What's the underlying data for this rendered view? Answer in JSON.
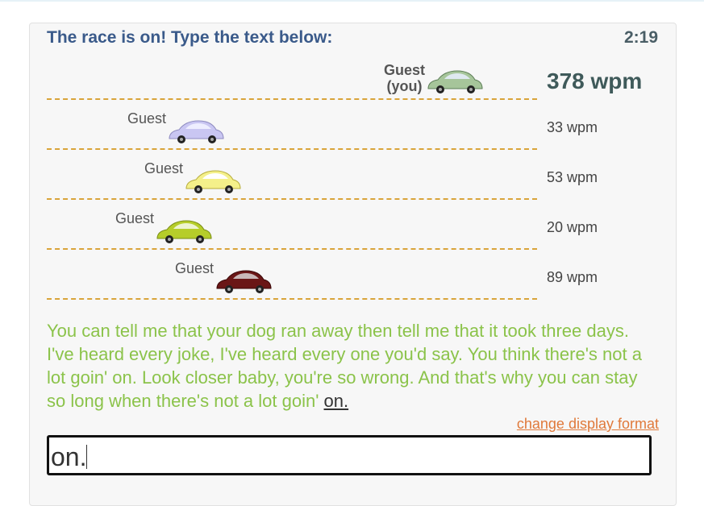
{
  "header": {
    "title": "The race is on! Type the text below:",
    "timer": "2:19"
  },
  "lanes": [
    {
      "name": "Guest\n(you)",
      "wpm": "378 wpm",
      "car_color": "#a6c59a",
      "is_you": true
    },
    {
      "name": "Guest",
      "wpm": "33 wpm",
      "car_color": "#c9c6f2",
      "is_you": false
    },
    {
      "name": "Guest",
      "wpm": "53 wpm",
      "car_color": "#f4f08a",
      "is_you": false
    },
    {
      "name": "Guest",
      "wpm": "20 wpm",
      "car_color": "#b6cd2a",
      "is_you": false
    },
    {
      "name": "Guest",
      "wpm": "89 wpm",
      "car_color": "#6a1616",
      "is_you": false
    }
  ],
  "passage": {
    "typed": "You can tell me that your dog ran away then tell me that it took three days. I've heard every joke, I've heard every one you'd say. You think there's not a lot goin' on. Look closer baby, you're so wrong. And that's why you can stay so long when there's not a lot goin' ",
    "current_word": "on."
  },
  "change_format_link": "change display format",
  "input": {
    "value": "on."
  },
  "colors": {
    "title": "#3a5a8a",
    "typed_text": "#8bc34a",
    "lane_line": "#d9a43a",
    "link": "#e0793a"
  }
}
